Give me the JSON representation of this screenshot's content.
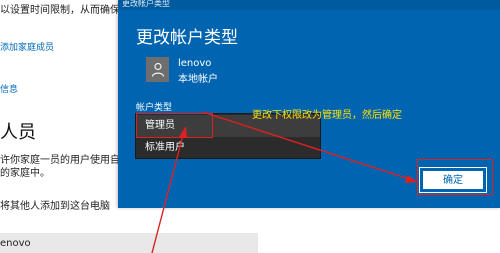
{
  "background": {
    "line1": "以设置时间限制，从而确保",
    "line2": "添加家庭成员",
    "line3": "信息",
    "heading": "人员",
    "line4": "许你家庭一员的用户使用自己",
    "line5": "的家庭中。",
    "line6": "将其他人添加到这台电脑",
    "line7": "enovo"
  },
  "dialog": {
    "titlebar": "更改帐户类型",
    "title": "更改帐户类型",
    "user_name": "lenovo",
    "user_type": "本地帐户",
    "type_label": "帐户类型",
    "options": [
      "管理员",
      "标准用户"
    ],
    "confirm_label": "确定"
  },
  "annotation": {
    "instruction": "更改下权限改为管理员，然后确定"
  },
  "colors": {
    "dialog_bg": "#0064b0",
    "annotation_text": "#ffe100",
    "annotation_marker": "#e02020"
  }
}
